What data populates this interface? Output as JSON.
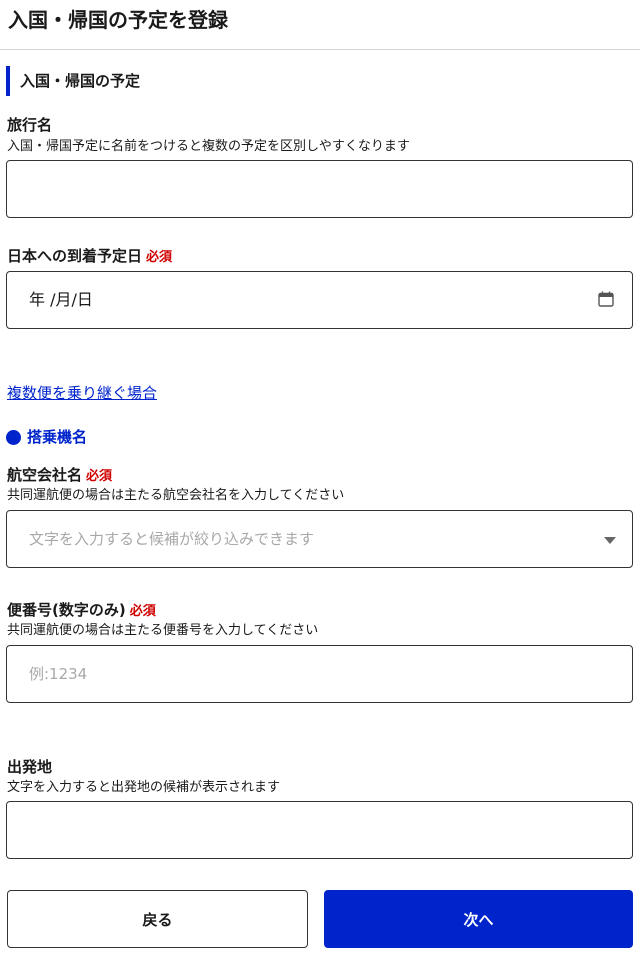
{
  "header": {
    "title": "入国・帰国の予定を登録"
  },
  "section": {
    "title": "入国・帰国の予定"
  },
  "trip_name": {
    "label": "旅行名",
    "help": "入国・帰国予定に名前をつけると複数の予定を区別しやすくなります",
    "value": ""
  },
  "arrival_date": {
    "label": "日本への到着予定日",
    "required": "必須",
    "value": "年 /月/日",
    "icon": "calendar-icon"
  },
  "multi_flight_link": "複数便を乗り継ぐ場合",
  "flight_section": {
    "title": "搭乗機名"
  },
  "airline": {
    "label": "航空会社名",
    "required": "必須",
    "help": "共同運航便の場合は主たる航空会社名を入力してください",
    "placeholder": "文字を入力すると候補が絞り込みできます",
    "icon": "dropdown-icon"
  },
  "flight_number": {
    "label": "便番号(数字のみ)",
    "required": "必須",
    "help": "共同運航便の場合は主たる便番号を入力してください",
    "placeholder": "例:1234"
  },
  "departure": {
    "label": "出発地",
    "help": "文字を入力すると出発地の候補が表示されます",
    "value": ""
  },
  "buttons": {
    "back": "戻る",
    "next": "次へ"
  },
  "colors": {
    "accent": "#0024cc",
    "required": "#d00000"
  }
}
